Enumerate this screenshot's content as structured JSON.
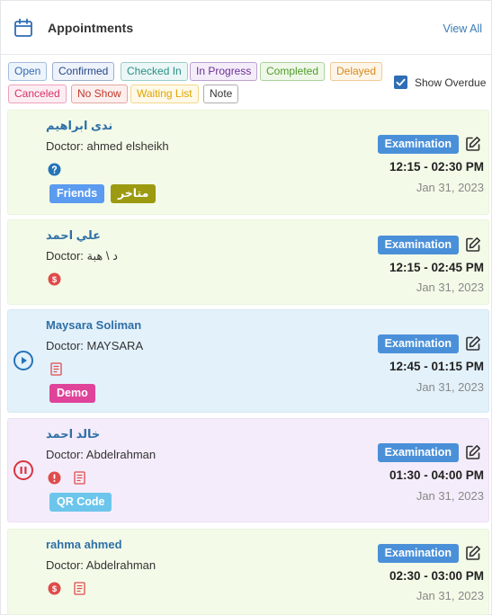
{
  "header": {
    "title": "Appointments",
    "view_all": "View All"
  },
  "filters": {
    "chips": [
      {
        "label": "Open",
        "color": "#2f6db5",
        "bg": "#eef4fb"
      },
      {
        "label": "Confirmed",
        "color": "#24498a",
        "bg": "#eef2fa"
      },
      {
        "label": "Checked In",
        "color": "#2a8f86",
        "bg": "#eaf7f6"
      },
      {
        "label": "In Progress",
        "color": "#6a2f96",
        "bg": "#f4edf9"
      },
      {
        "label": "Completed",
        "color": "#4e9b2c",
        "bg": "#eff8e8"
      },
      {
        "label": "Delayed",
        "color": "#d98a1c",
        "bg": "#fdf5e8"
      },
      {
        "label": "Canceled",
        "color": "#d6336c",
        "bg": "#fcedf2"
      },
      {
        "label": "No Show",
        "color": "#c0392b",
        "bg": "#fcefee"
      },
      {
        "label": "Waiting List",
        "color": "#e0a500",
        "bg": "#fef9e8"
      },
      {
        "label": "Note",
        "color": "#333333",
        "bg": "#ffffff"
      }
    ],
    "show_overdue_label": "Show Overdue",
    "show_overdue_checked": true
  },
  "appointments": [
    {
      "name": "ندى ابراهيم",
      "doctor": "Doctor: ahmed elsheikh",
      "badge": "Examination",
      "time": "12:15 - 02:30 PM",
      "date": "Jan 31, 2023",
      "state_icon": "",
      "status_icons": [
        "help-icon"
      ],
      "tags": [
        {
          "label": "Friends",
          "color": "#5b9bf0"
        },
        {
          "label": "متاخر",
          "color": "#9c9a10"
        }
      ]
    },
    {
      "name": "علي احمد",
      "doctor": "Doctor: د \\ هبة",
      "badge": "Examination",
      "time": "12:15 - 02:45 PM",
      "date": "Jan 31, 2023",
      "state_icon": "",
      "status_icons": [
        "dollar-icon"
      ],
      "tags": []
    },
    {
      "name": "Maysara Soliman",
      "doctor": "Doctor: MAYSARA",
      "badge": "Examination",
      "time": "12:45 - 01:15 PM",
      "date": "Jan 31, 2023",
      "state_icon": "play-icon",
      "status_icons": [
        "note-icon"
      ],
      "tags": [
        {
          "label": "Demo",
          "color": "#e0439a"
        }
      ]
    },
    {
      "name": "خالد احمد",
      "doctor": "Doctor: Abdelrahman",
      "badge": "Examination",
      "time": "01:30 - 04:00 PM",
      "date": "Jan 31, 2023",
      "state_icon": "pause-icon",
      "status_icons": [
        "alert-icon",
        "note-icon"
      ],
      "tags": [
        {
          "label": "QR Code",
          "color": "#6cc6ec"
        }
      ]
    },
    {
      "name": "rahma ahmed",
      "doctor": "Doctor: Abdelrahman",
      "badge": "Examination",
      "time": "02:30 - 03:00 PM",
      "date": "Jan 31, 2023",
      "state_icon": "",
      "status_icons": [
        "dollar-icon",
        "note-icon"
      ],
      "tags": []
    }
  ]
}
